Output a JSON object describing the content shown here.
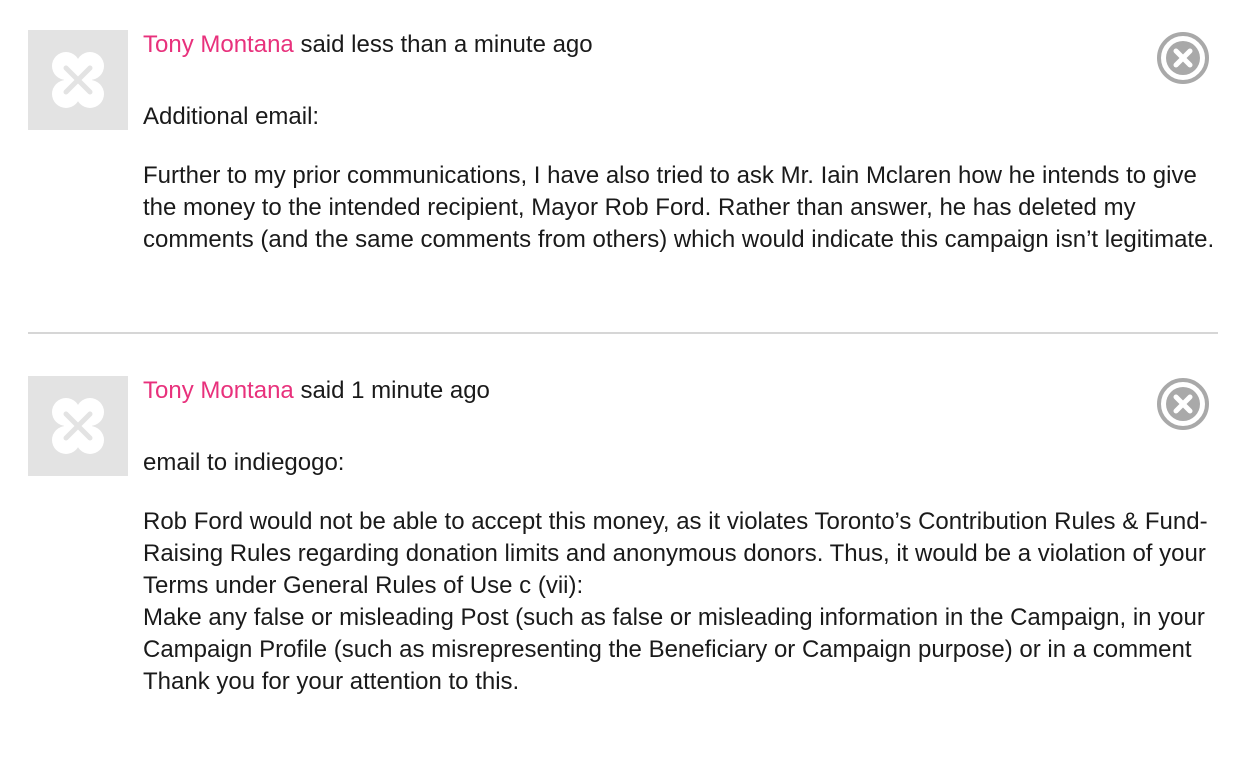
{
  "comments": [
    {
      "author": "Tony Montana",
      "said_text": "said less than a minute ago",
      "subject": "Additional email:",
      "paragraphs": [
        "Further to my prior communications, I have also tried to ask Mr. Iain Mclaren how he intends to give the money to the intended recipient, Mayor Rob Ford. Rather than answer, he has deleted my comments (and the same comments from others) which would indicate this campaign isn’t legitimate."
      ]
    },
    {
      "author": "Tony Montana",
      "said_text": "said 1 minute ago",
      "subject": "email to indiegogo:",
      "paragraphs": [
        "Rob Ford would not be able to accept this money, as it violates Toronto’s Contribution Rules & Fund-Raising Rules regarding donation limits and anonymous donors. Thus, it would be a violation of your Terms under General Rules of Use c (vii):",
        "Make any false or misleading Post (such as false or misleading information in the Campaign, in your Campaign Profile (such as misrepresenting the Beneficiary or Campaign purpose) or in a comment",
        "Thank you for your attention to this."
      ]
    }
  ],
  "colors": {
    "author_link": "#e8317c",
    "avatar_bg": "#e3e3e3",
    "close_icon": "#a9a9a9",
    "divider": "#d6d6d6"
  },
  "icons": {
    "avatar": "clover-placeholder-icon",
    "delete": "close-circle-icon"
  }
}
